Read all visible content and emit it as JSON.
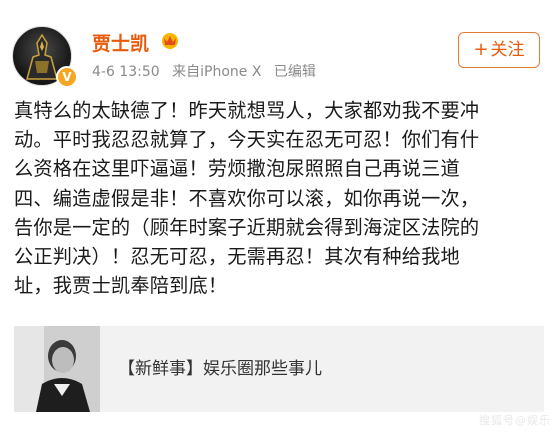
{
  "user": {
    "name": "贾士凯",
    "date": "4-6 13:50",
    "source": "来自iPhone X",
    "edited": "已编辑",
    "follow_label": "关注",
    "follow_symbol": "+"
  },
  "post": {
    "lines": [
      "真特么的太缺德了！昨天就想骂人，大家都劝我不要冲",
      "动。平时我忍忍就算了，今天实在忍无可忍！你们有什",
      "么资格在这里吓逼逼！劳烦撒泡尿照照自己再说三道",
      "四、编造虚假是非！不喜欢你可以滚，如你再说一次，",
      "告你是一定的（顾年时案子近期就会得到海淀区法院的",
      "公正判决）！忍无可忍，无需再忍！其次有种给我地",
      "址，我贾士凯奉陪到底！"
    ]
  },
  "card": {
    "label": "【新鲜事】娱乐圈那些事儿"
  },
  "watermark": "搜狐号@娱乐"
}
